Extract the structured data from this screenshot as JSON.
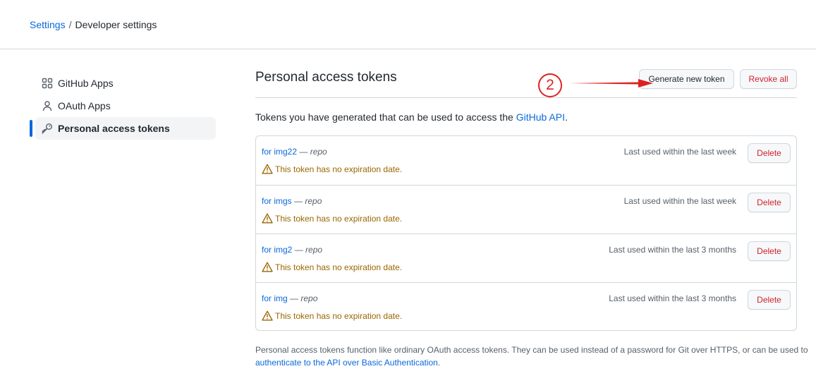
{
  "breadcrumb": {
    "settings": "Settings",
    "sep": "/",
    "current": "Developer settings"
  },
  "sidebar": {
    "items": [
      {
        "label": "GitHub Apps",
        "icon": "apps-icon"
      },
      {
        "label": "OAuth Apps",
        "icon": "person-icon"
      },
      {
        "label": "Personal access tokens",
        "icon": "key-icon",
        "active": true
      }
    ]
  },
  "main": {
    "title": "Personal access tokens",
    "generate_label": "Generate new token",
    "revoke_label": "Revoke all",
    "intro_text": "Tokens you have generated that can be used to access the ",
    "intro_link": "GitHub API",
    "intro_end": "."
  },
  "annotation": {
    "number": "2",
    "color": "#e02020"
  },
  "tokens": [
    {
      "name": "for img22",
      "dash": " — ",
      "scope": "repo",
      "warning": "This token has no expiration date.",
      "last_used": "Last used within the last week",
      "delete_label": "Delete"
    },
    {
      "name": "for imgs",
      "dash": " — ",
      "scope": "repo",
      "warning": "This token has no expiration date.",
      "last_used": "Last used within the last week",
      "delete_label": "Delete"
    },
    {
      "name": "for img2",
      "dash": " — ",
      "scope": "repo",
      "warning": "This token has no expiration date.",
      "last_used": "Last used within the last 3 months",
      "delete_label": "Delete"
    },
    {
      "name": "for img",
      "dash": " — ",
      "scope": "repo",
      "warning": "This token has no expiration date.",
      "last_used": "Last used within the last 3 months",
      "delete_label": "Delete"
    }
  ],
  "footer": {
    "text": "Personal access tokens function like ordinary OAuth access tokens. They can be used instead of a password for Git over HTTPS, or can be used to ",
    "link": "authenticate to the API over Basic Authentication",
    "end": "."
  },
  "colors": {
    "link": "#0969da",
    "danger": "#cf222e",
    "warning": "#9a6700",
    "border": "#d0d7de"
  }
}
